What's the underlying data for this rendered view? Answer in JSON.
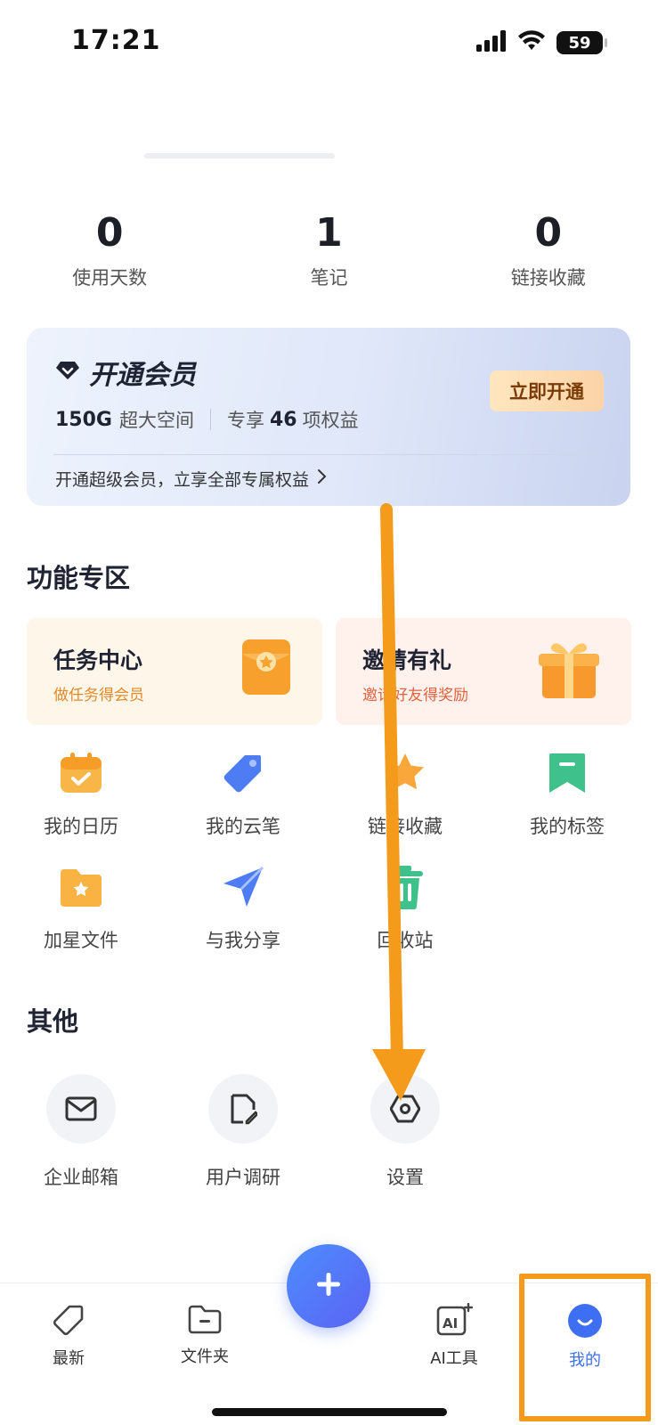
{
  "status_bar": {
    "time": "17:21",
    "battery": "59"
  },
  "stats": [
    {
      "value": "0",
      "label": "使用天数"
    },
    {
      "value": "1",
      "label": "笔记"
    },
    {
      "value": "0",
      "label": "链接收藏"
    }
  ],
  "vip": {
    "title": "开通会员",
    "storage_value": "150G",
    "storage_text": "超大空间",
    "benefits_prefix": "专享",
    "benefits_count": "46",
    "benefits_suffix": "项权益",
    "button": "立即开通",
    "promo": "开通超级会员，立享全部专属权益"
  },
  "features": {
    "title": "功能专区",
    "promos": [
      {
        "title": "任务中心",
        "subtitle": "做任务得会员"
      },
      {
        "title": "邀请有礼",
        "subtitle": "邀请好友得奖励"
      }
    ],
    "items": [
      {
        "label": "我的日历",
        "icon": "calendar-icon"
      },
      {
        "label": "我的云笔",
        "icon": "pen-tag-icon"
      },
      {
        "label": "链接收藏",
        "icon": "star-icon"
      },
      {
        "label": "我的标签",
        "icon": "bookmark-icon"
      },
      {
        "label": "加星文件",
        "icon": "star-folder-icon"
      },
      {
        "label": "与我分享",
        "icon": "share-arrow-icon"
      },
      {
        "label": "回收站",
        "icon": "trash-icon"
      }
    ]
  },
  "other": {
    "title": "其他",
    "items": [
      {
        "label": "企业邮箱",
        "icon": "mail-icon"
      },
      {
        "label": "用户调研",
        "icon": "survey-icon"
      },
      {
        "label": "设置",
        "icon": "gear-icon"
      }
    ]
  },
  "tabbar": {
    "items": [
      {
        "label": "最新",
        "icon": "tag-icon"
      },
      {
        "label": "文件夹",
        "icon": "folder-icon"
      },
      {
        "label": "AI工具",
        "icon": "ai-tool-icon"
      },
      {
        "label": "我的",
        "icon": "profile-icon"
      }
    ]
  },
  "colors": {
    "accent": "#3e6ff2",
    "orange": "#f49b1c",
    "vip_button": "#fcd3a7"
  }
}
